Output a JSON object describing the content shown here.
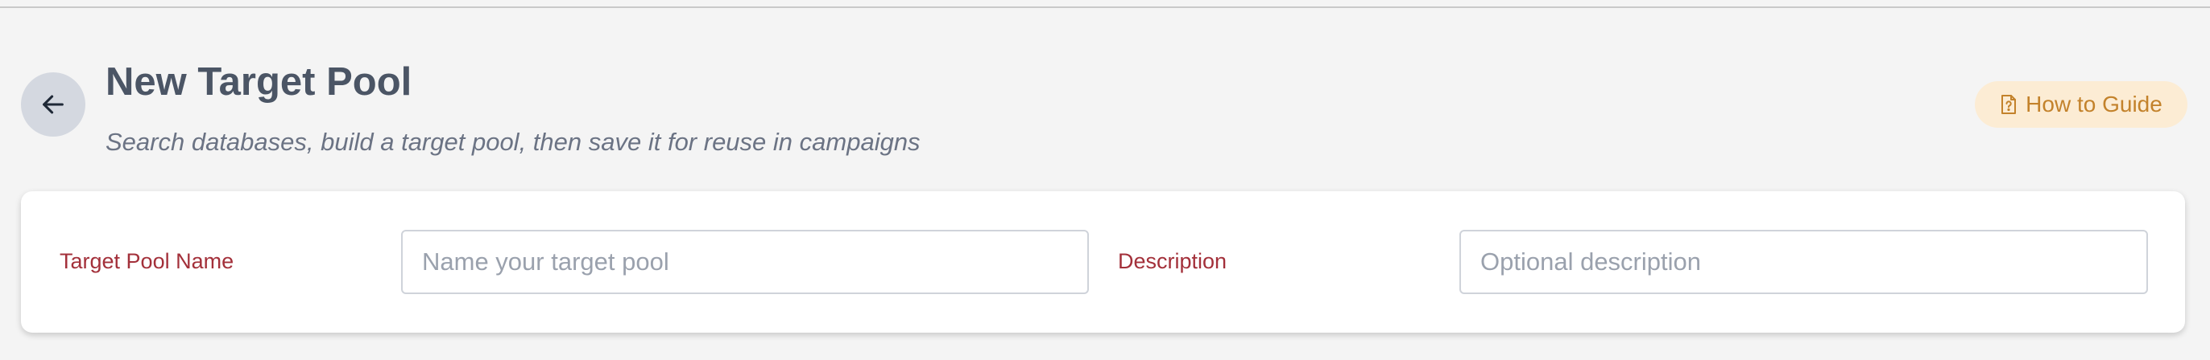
{
  "header": {
    "title": "New Target Pool",
    "subtitle": "Search databases, build a target pool, then save it for reuse in campaigns",
    "back_icon": "arrow-left-icon",
    "guide_button": {
      "label": "How to Guide",
      "icon": "document-question-icon"
    }
  },
  "form": {
    "name_label": "Target Pool Name",
    "name_value": "",
    "name_placeholder": "Name your target pool",
    "description_label": "Description",
    "description_value": "",
    "description_placeholder": "Optional description"
  },
  "colors": {
    "background": "#f4f4f4",
    "title": "#4b5565",
    "label": "#a3303a",
    "guide_accent": "#c3822b",
    "guide_background": "#fcecd4"
  }
}
